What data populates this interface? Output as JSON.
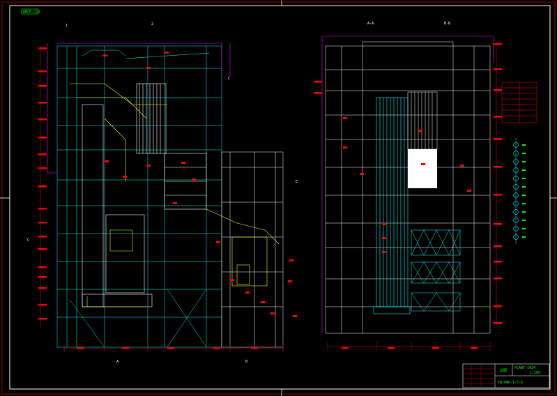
{
  "sheet": {
    "corner_tag": "BMCR-CAD",
    "left_view": {
      "top_markers": [
        "1",
        "2"
      ],
      "bottom_markers": [
        "A",
        "B"
      ],
      "side_markers": [
        "C",
        "C",
        "E"
      ]
    },
    "right_view": {
      "top_markers": [
        "A-A",
        "B-B"
      ]
    },
    "title_block": {
      "code": "PLANT-1024",
      "title": "总图",
      "drawing_no": "TB-DWG-1-5-6",
      "scale": "1:100"
    }
  },
  "colors": {
    "background": "#000000",
    "frame": "#ffffff",
    "structure": "#00ffff",
    "dimension": "#ff0000",
    "boiler": "#ffffff",
    "highlight": "#ffff00",
    "annotation": "#00ff00",
    "accent": "#ff00ff"
  }
}
